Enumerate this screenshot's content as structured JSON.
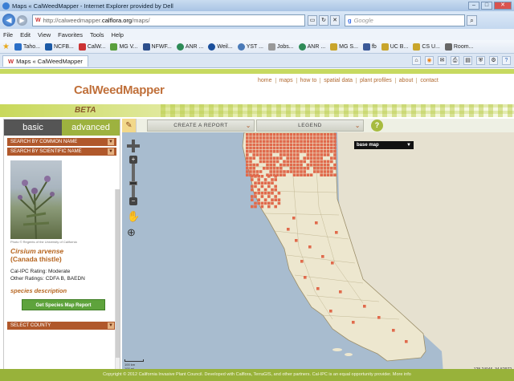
{
  "browser": {
    "window_title": "Maps « CalWeedMapper - Internet Explorer provided by Dell",
    "url_prefix": "http://calweedmapper.",
    "url_domain": "calflora.org",
    "url_path": "/maps/",
    "search_placeholder": "Google",
    "menu": [
      "File",
      "Edit",
      "View",
      "Favorites",
      "Tools",
      "Help"
    ],
    "favorites": [
      "Taho...",
      "NCFB...",
      "CalW...",
      "MG V...",
      "NFWF...",
      "ANR ...",
      "Weil...",
      "YST ...",
      "Jobs...",
      "ANR ...",
      "MG S...",
      "fb",
      "UC B...",
      "CS U...",
      "Room..."
    ],
    "tab_label": "Maps « CalWeedMapper"
  },
  "site": {
    "logo": "CalWeedMapper",
    "nav": [
      "home",
      "maps",
      "how to",
      "spatial data",
      "plant profiles",
      "about",
      "contact"
    ],
    "beta": "BETA"
  },
  "sidebar": {
    "tab_basic": "basic",
    "tab_advanced": "advanced",
    "search_common": "SEARCH BY COMMON NAME",
    "search_scientific": "SEARCH BY SCIENTIFIC NAME",
    "photo_caption": "Photo © Regents of the University of California",
    "scientific_name": "Cirsium arvense",
    "common_name": "(Canada thistle)",
    "cal_ipc_rating": "Cal-IPC Rating: Moderate",
    "other_ratings": "Other Ratings: CDFA B, BAEDN",
    "species_description": "species description",
    "get_report_button": "Get Species Map Report",
    "select_county": "SELECT COUNTY"
  },
  "map": {
    "create_report": "CREATE A REPORT",
    "legend": "LEGEND",
    "help": "?",
    "base_map": "base map",
    "scale_top": "100 km",
    "scale_bottom": "100 mi",
    "coordinates": "-128.24046, 34.52972"
  },
  "footer": {
    "text": "Copyright © 2012 California Invasive Plant Council. Developed with Calflora, TerraGIS, and other partners. Cal-IPC is an equal opportunity provider. More info"
  },
  "colors": {
    "brand_green": "#98b23a",
    "brand_orange": "#b0582b",
    "occupied_cell": "#e06a4c",
    "ocean": "#a8bccf"
  }
}
